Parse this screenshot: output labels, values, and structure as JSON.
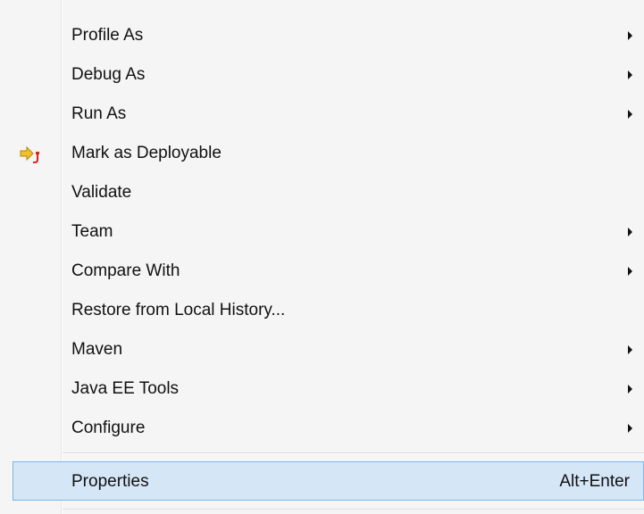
{
  "menu": {
    "items": [
      {
        "label": "Profile As",
        "submenu": true
      },
      {
        "label": "Debug As",
        "submenu": true
      },
      {
        "label": "Run As",
        "submenu": true
      },
      {
        "label": "Mark as Deployable",
        "submenu": false,
        "icon": "deploy-icon"
      },
      {
        "label": "Validate",
        "submenu": false
      },
      {
        "label": "Team",
        "submenu": true
      },
      {
        "label": "Compare With",
        "submenu": true
      },
      {
        "label": "Restore from Local History...",
        "submenu": false
      },
      {
        "label": "Maven",
        "submenu": true
      },
      {
        "label": "Java EE Tools",
        "submenu": true
      },
      {
        "label": "Configure",
        "submenu": true
      }
    ],
    "properties": {
      "label": "Properties",
      "shortcut": "Alt+Enter",
      "highlighted": true
    }
  },
  "colors": {
    "menu_background": "#f5f5f5",
    "highlight_fill": "#d5e6f7",
    "highlight_border": "#7eb4ea",
    "icon_yellow": "#f2c029",
    "icon_red": "#d9261c"
  }
}
